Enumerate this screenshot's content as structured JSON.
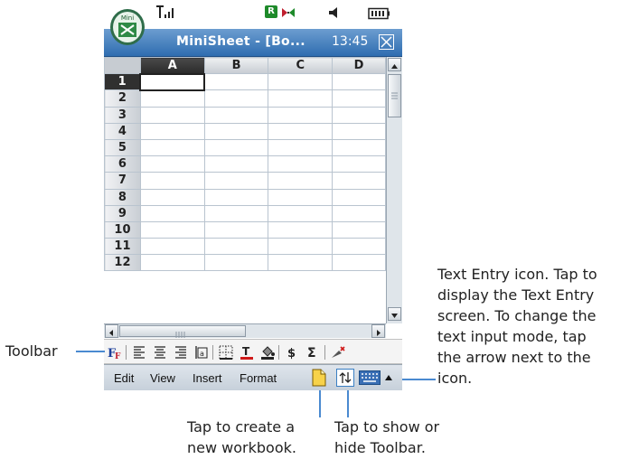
{
  "status_bar": {
    "signal_icon": "signal-strength-icon",
    "roaming_badge": "R",
    "bluetooth_icon": "bluetooth-icon",
    "speaker_icon": "speaker-icon",
    "battery_icon": "battery-icon"
  },
  "title_bar": {
    "app_logo_label": "Mini",
    "title": "MiniSheet - [Bo...",
    "clock": "13:45",
    "close_icon": "close-icon"
  },
  "sheet": {
    "columns": [
      "A",
      "B",
      "C",
      "D"
    ],
    "rows": [
      "1",
      "2",
      "3",
      "4",
      "5",
      "6",
      "7",
      "8",
      "9",
      "10",
      "11",
      "12"
    ],
    "selected_cell": "A1"
  },
  "toolbar": {
    "buttons": [
      "font-format-icon",
      "align-left-icon",
      "align-center-icon",
      "align-right-icon",
      "wrap-text-icon",
      "borders-icon",
      "font-color-icon",
      "fill-color-icon",
      "currency-icon",
      "autosum-icon",
      "insert-chart-icon"
    ],
    "currency_symbol": "$",
    "sum_symbol": "Σ"
  },
  "menu_bar": {
    "items": [
      "Edit",
      "View",
      "Insert",
      "Format"
    ]
  },
  "callouts": {
    "toolbar": "Toolbar",
    "text_entry": [
      "Text Entry icon. Tap to",
      "display the Text Entry",
      "screen. To change the",
      "text input mode, tap",
      "the arrow next to the",
      "icon."
    ],
    "new_workbook": [
      "Tap to create a",
      "new workbook."
    ],
    "toggle_toolbar": [
      "Tap to show or",
      "hide Toolbar."
    ]
  },
  "colors": {
    "title_bar": "#2f6db0",
    "accent": "#4a8ad0"
  }
}
